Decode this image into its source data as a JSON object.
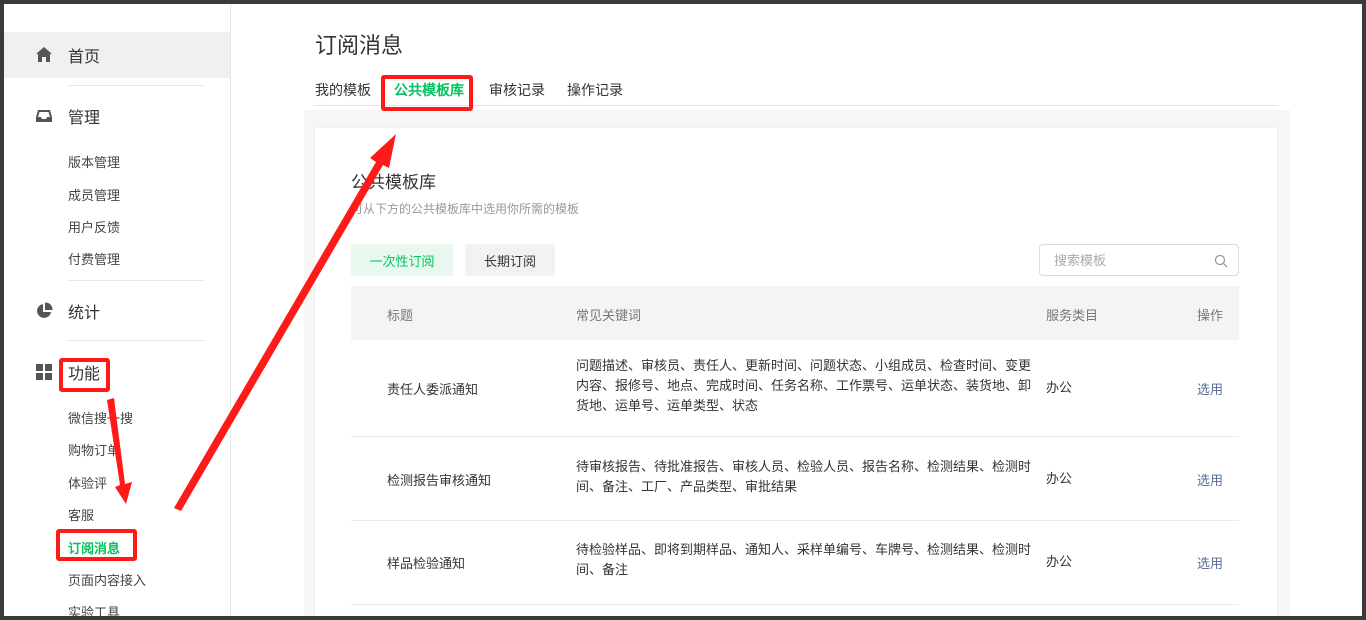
{
  "sidebar": {
    "home": "首页",
    "manage": "管理",
    "manage_items": [
      "版本管理",
      "成员管理",
      "用户反馈",
      "付费管理"
    ],
    "stats": "统计",
    "features": "功能",
    "feature_items": [
      "微信搜一搜",
      "购物订单",
      "体验评",
      "客服",
      "订阅消息",
      "页面内容接入",
      "实验工具"
    ]
  },
  "page": {
    "title": "订阅消息",
    "tabs": [
      "我的模板",
      "公共模板库",
      "审核记录",
      "操作记录"
    ],
    "active_tab": "公共模板库"
  },
  "library": {
    "title": "公共模板库",
    "desc": "可从下方的公共模板库中选用你所需的模板",
    "btn_once": "一次性订阅",
    "btn_long": "长期订阅",
    "search_placeholder": "搜索模板"
  },
  "table": {
    "headers": [
      "标题",
      "常见关键词",
      "服务类目",
      "操作"
    ],
    "rows": [
      {
        "title": "责任人委派通知",
        "keywords": "问题描述、审核员、责任人、更新时间、问题状态、小组成员、检查时间、变更内容、报修号、地点、完成时间、任务名称、工作票号、运单状态、装货地、卸货地、运单号、运单类型、状态",
        "category": "办公",
        "action": "选用"
      },
      {
        "title": "检测报告审核通知",
        "keywords": "待审核报告、待批准报告、审核人员、检验人员、报告名称、检测结果、检测时间、备注、工厂、产品类型、审批结果",
        "category": "办公",
        "action": "选用"
      },
      {
        "title": "样品检验通知",
        "keywords": "待检验样品、即将到期样品、通知人、采样单编号、车牌号、检测结果、检测时间、备注",
        "category": "办公",
        "action": "选用"
      }
    ]
  },
  "colors": {
    "accent": "#07c160",
    "annotation": "#ff1a1a",
    "link": "#576b95"
  },
  "icons": [
    "home-icon",
    "inbox-icon",
    "pie-chart-icon",
    "grid-icon",
    "search-icon"
  ]
}
